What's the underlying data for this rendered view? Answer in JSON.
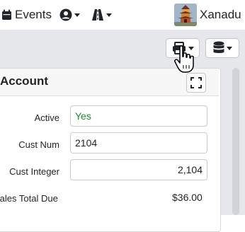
{
  "navbar": {
    "events_label": "Events",
    "user_name": "Xanadu"
  },
  "toolbar": {
    "print_icon": "printer-icon",
    "database_icon": "database-icon"
  },
  "card": {
    "title": "Account",
    "fields": [
      {
        "label": "Active",
        "value": "Yes"
      },
      {
        "label": "Cust Num",
        "value": "2104"
      },
      {
        "label": "Cust Integer",
        "value": "2,104"
      },
      {
        "label": "Sales Total Due",
        "value": "$36.00"
      }
    ]
  },
  "colors": {
    "accent_green": "#1e8c2f",
    "workarea_bg": "#e5e7ea"
  }
}
